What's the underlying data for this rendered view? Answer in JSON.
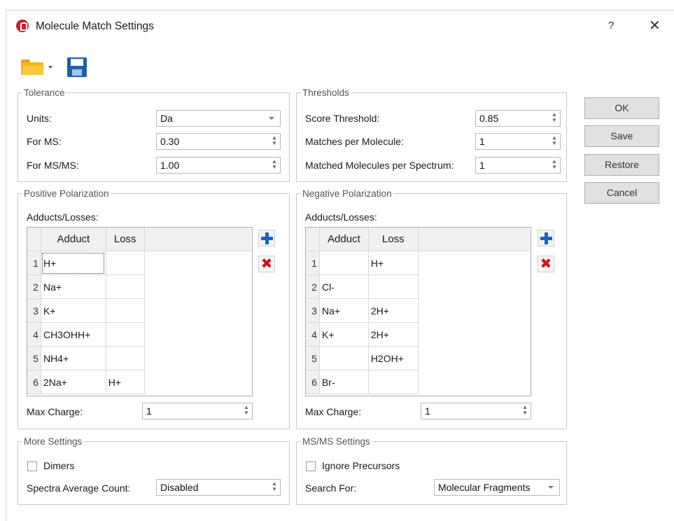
{
  "window": {
    "title": "Molecule Match Settings",
    "help": "?",
    "close": "✕",
    "accent": "#c8202f"
  },
  "toolbar": {
    "open_icon": "folder-open-icon",
    "save_icon": "floppy-disk-icon"
  },
  "tolerance": {
    "legend": "Tolerance",
    "units_label": "Units:",
    "units_value": "Da",
    "ms_label": "For MS:",
    "ms_value": "0.30",
    "msms_label": "For MS/MS:",
    "msms_value": "1.00"
  },
  "thresholds": {
    "legend": "Thresholds",
    "score_label": "Score Threshold:",
    "score_value": "0.85",
    "matches_label": "Matches per Molecule:",
    "matches_value": "1",
    "matched_label": "Matched Molecules per Spectrum:",
    "matched_value": "1"
  },
  "buttons": {
    "ok": "OK",
    "save": "Save",
    "restore": "Restore",
    "cancel": "Cancel"
  },
  "positive": {
    "legend": "Positive Polarization",
    "adducts_label": "Adducts/Losses:",
    "col_adduct": "Adduct",
    "col_loss": "Loss",
    "rows": [
      {
        "n": "1",
        "adduct": "H+",
        "loss": ""
      },
      {
        "n": "2",
        "adduct": "Na+",
        "loss": ""
      },
      {
        "n": "3",
        "adduct": "K+",
        "loss": ""
      },
      {
        "n": "4",
        "adduct": "CH3OHH+",
        "loss": ""
      },
      {
        "n": "5",
        "adduct": "NH4+",
        "loss": ""
      },
      {
        "n": "6",
        "adduct": "2Na+",
        "loss": "H+"
      }
    ],
    "max_charge_label": "Max Charge:",
    "max_charge_value": "1"
  },
  "negative": {
    "legend": "Negative Polarization",
    "adducts_label": "Adducts/Losses:",
    "col_adduct": "Adduct",
    "col_loss": "Loss",
    "rows": [
      {
        "n": "1",
        "adduct": "",
        "loss": "H+"
      },
      {
        "n": "2",
        "adduct": "Cl-",
        "loss": ""
      },
      {
        "n": "3",
        "adduct": "Na+",
        "loss": "2H+"
      },
      {
        "n": "4",
        "adduct": "K+",
        "loss": "2H+"
      },
      {
        "n": "5",
        "adduct": "",
        "loss": "H2OH+"
      },
      {
        "n": "6",
        "adduct": "Br-",
        "loss": ""
      }
    ],
    "max_charge_label": "Max Charge:",
    "max_charge_value": "1"
  },
  "more": {
    "legend": "More Settings",
    "dimers_label": "Dimers",
    "dimers_checked": false,
    "avg_label": "Spectra Average Count:",
    "avg_value": "Disabled"
  },
  "msms": {
    "legend": "MS/MS Settings",
    "ignore_label": "Ignore Precursors",
    "ignore_checked": false,
    "search_label": "Search For:",
    "search_value": "Molecular Fragments"
  }
}
